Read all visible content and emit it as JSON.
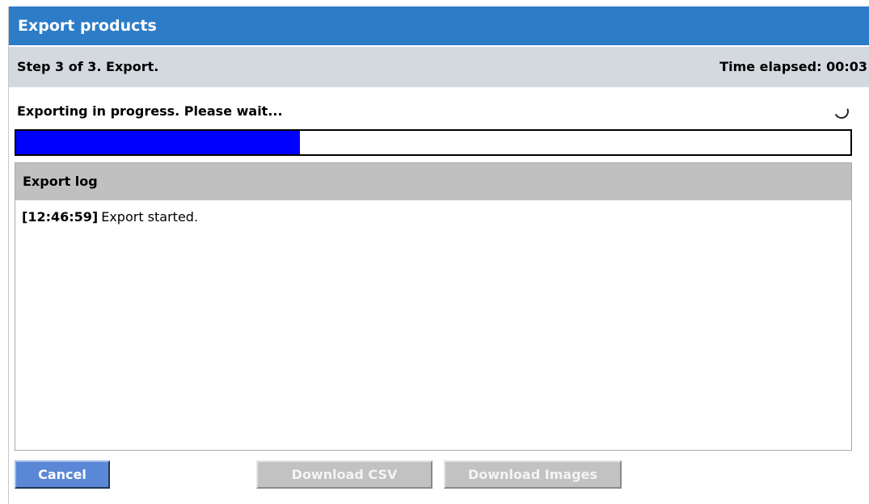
{
  "dialog": {
    "title": "Export products",
    "step_text": "Step 3 of 3. Export.",
    "time_elapsed": "Time elapsed: 00:03"
  },
  "status": {
    "text": "Exporting in progress. Please wait...",
    "spinner_icon": "loading-spinner-icon"
  },
  "progress": {
    "fraction": 0.34,
    "fill_color": "#0000ff"
  },
  "log": {
    "header": "Export log",
    "entries": [
      {
        "time": "[12:46:59]",
        "message": "Export started."
      }
    ]
  },
  "buttons": {
    "cancel": "Cancel",
    "download_csv": "Download CSV",
    "download_images": "Download Images"
  },
  "colors": {
    "title_bar": "#2d7cc7",
    "step_bar": "#d4d8df",
    "log_header": "#c0c0c0",
    "cancel_button": "#5b88d6",
    "disabled_button": "#c2c2c2"
  }
}
